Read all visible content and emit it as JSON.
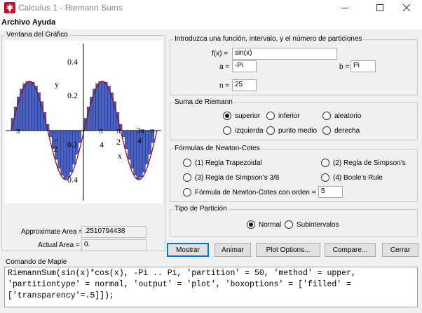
{
  "window": {
    "title": "Calculus 1 - Riemann Sums"
  },
  "menu": [
    "Archivo",
    "Ayuda"
  ],
  "plot": {
    "group_title": "Ventana del Gráfico",
    "x_ticks": [
      "−π",
      "π",
      "4",
      "π",
      "2",
      "3π",
      "4",
      "π"
    ],
    "y_ticks": [
      "0.4",
      "0.2",
      "0.2",
      "0.4"
    ],
    "x_extra": [
      "−",
      "2",
      "x"
    ],
    "y_label": "y",
    "colors": {
      "bar_fill": "#4a62c4",
      "bar_edge": "#1a2a6e",
      "curve": "#a00000"
    }
  },
  "areas": {
    "approx_label": "Approximate Area =",
    "approx_value": ".2510794438",
    "actual_label": "Actual Area =",
    "actual_value": "0."
  },
  "input": {
    "title": "Introduzca una función, intervalo, y el número de particiones",
    "fx_label": "f(x) =",
    "fx_value": "sin(x)",
    "a_label": "a =",
    "a_value": "-Pi",
    "b_label": "b =",
    "b_value": "Pi",
    "n_label": "n =",
    "n_value": "25"
  },
  "riemann": {
    "title": "Suma de Riemann",
    "options": [
      "superior",
      "inferior",
      "aleatorio",
      "izquierda",
      "punto medio",
      "derecha"
    ],
    "selected": "superior"
  },
  "newton_cotes": {
    "title": "Fórmulas de Newton-Cotes",
    "options": [
      "(1) Regla Trapezoidal",
      "(2) Regla de Simpson's",
      "(3) Regla de Simpson's 3/8",
      "(4) Boole's Rule",
      "Fórmula de Newton-Cotes con orden ="
    ],
    "order_value": "5"
  },
  "partition": {
    "title": "Tipo de Partición",
    "options": [
      "Normal",
      "Subintervalos"
    ],
    "selected": "Normal"
  },
  "buttons": [
    "Mostrar",
    "Animar",
    "Plot Options...",
    "Compare...",
    "Cerrar"
  ],
  "maple": {
    "title": "Comando de Maple",
    "lines": [
      "RiemannSum(sin(x)*cos(x), -Pi .. Pi, 'partition' = 50, 'method' = upper,",
      "'partitiontype' = normal, 'output' = 'plot', 'boxoptions' = ['filled' =",
      "['transparency'=.5]]);"
    ]
  }
}
